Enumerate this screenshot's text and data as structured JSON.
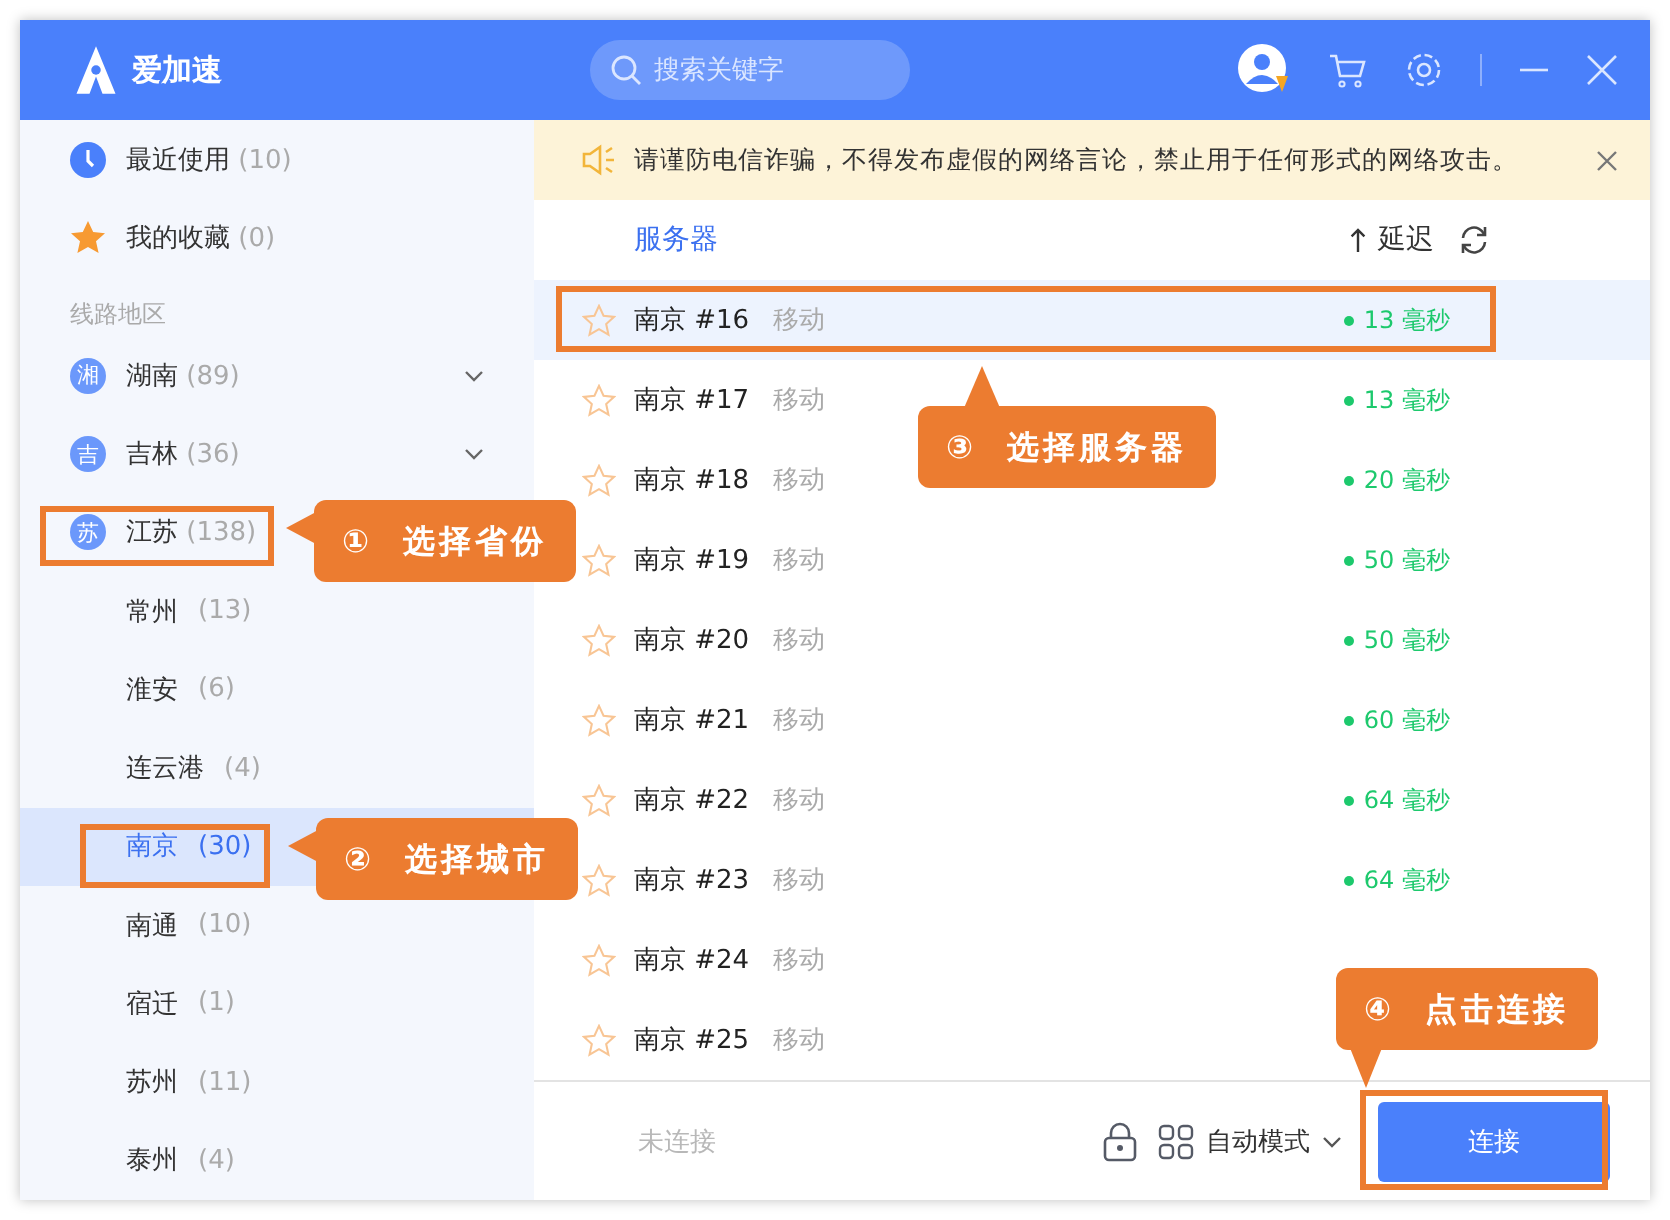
{
  "app": {
    "name": "爱加速"
  },
  "search": {
    "placeholder": "搜索关键字"
  },
  "sidebar": {
    "quick": [
      {
        "kind": "recent",
        "label": "最近使用",
        "count": "(10)"
      },
      {
        "kind": "favorite",
        "label": "我的收藏",
        "count": "(0)"
      }
    ],
    "section_title": "线路地区",
    "regions": [
      {
        "badge": "湘",
        "label": "湖南",
        "count": "(89)",
        "expanded": false
      },
      {
        "badge": "吉",
        "label": "吉林",
        "count": "(36)",
        "expanded": false
      },
      {
        "badge": "苏",
        "label": "江苏",
        "count": "(138)",
        "expanded": true,
        "children": [
          {
            "label": "常州",
            "count": "(13)",
            "selected": false
          },
          {
            "label": "淮安",
            "count": "(6)",
            "selected": false
          },
          {
            "label": "连云港",
            "count": "(4)",
            "selected": false
          },
          {
            "label": "南京",
            "count": "(30)",
            "selected": true
          },
          {
            "label": "南通",
            "count": "(10)",
            "selected": false
          },
          {
            "label": "宿迁",
            "count": "(1)",
            "selected": false
          },
          {
            "label": "苏州",
            "count": "(11)",
            "selected": false
          },
          {
            "label": "泰州",
            "count": "(4)",
            "selected": false
          }
        ]
      }
    ]
  },
  "notice": {
    "text": "请谨防电信诈骗，不得发布虚假的网络言论，禁止用于任何形式的网络攻击。"
  },
  "server_list": {
    "column": "服务器",
    "sort_label": "延迟",
    "servers": [
      {
        "name": "南京 #16",
        "carrier": "移动",
        "latency": "13 毫秒",
        "selected": true
      },
      {
        "name": "南京 #17",
        "carrier": "移动",
        "latency": "13 毫秒",
        "selected": false
      },
      {
        "name": "南京 #18",
        "carrier": "移动",
        "latency": "20 毫秒",
        "selected": false
      },
      {
        "name": "南京 #19",
        "carrier": "移动",
        "latency": "50 毫秒",
        "selected": false
      },
      {
        "name": "南京 #20",
        "carrier": "移动",
        "latency": "50 毫秒",
        "selected": false
      },
      {
        "name": "南京 #21",
        "carrier": "移动",
        "latency": "60 毫秒",
        "selected": false
      },
      {
        "name": "南京 #22",
        "carrier": "移动",
        "latency": "64 毫秒",
        "selected": false
      },
      {
        "name": "南京 #23",
        "carrier": "移动",
        "latency": "64 毫秒",
        "selected": false
      },
      {
        "name": "南京 #24",
        "carrier": "移动",
        "selected": false
      },
      {
        "name": "南京 #25",
        "carrier": "移动",
        "selected": false
      }
    ]
  },
  "footer": {
    "status": "未连接",
    "mode": "自动模式",
    "connect_button": "连接"
  },
  "annotations": [
    {
      "number": "①",
      "text": "选择省份"
    },
    {
      "number": "②",
      "text": "选择城市"
    },
    {
      "number": "③",
      "text": "选择服务器"
    },
    {
      "number": "④",
      "text": "点击连接"
    }
  ]
}
